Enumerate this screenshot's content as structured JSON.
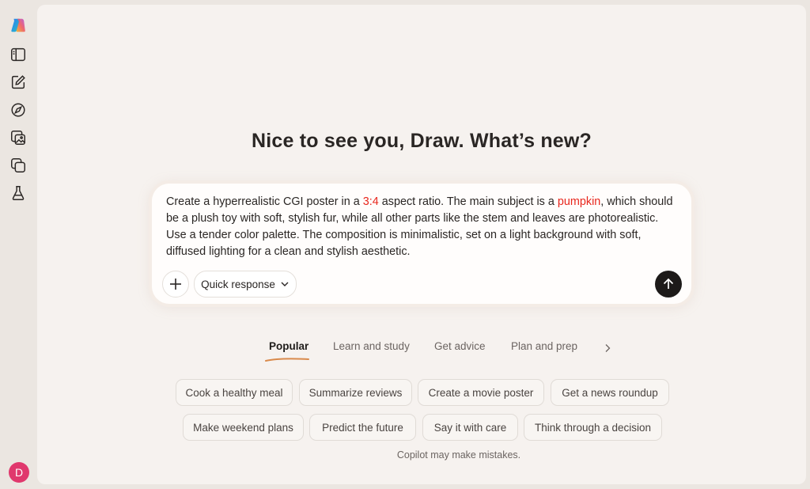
{
  "sidebar": {
    "icons": [
      "copilot-logo-icon",
      "sidebar-toggle-icon",
      "new-chat-icon",
      "discover-icon",
      "imagine-icon",
      "pages-icon",
      "labs-icon"
    ],
    "avatar_initial": "D",
    "avatar_color": "#e0386d"
  },
  "greeting": "Nice to see you, Draw. What’s new?",
  "composer": {
    "prompt_parts": [
      "Create a hyperrealistic CGI poster in a ",
      "3:4",
      " aspect ratio. The main subject is a ",
      "pumpkin",
      ", which should be a plush toy with soft, stylish fur, while all other parts like the stem and leaves are photorealistic. Use a tender color palette. The composition is minimalistic, set on a light background with soft, diffused lighting for a clean and stylish aesthetic."
    ],
    "highlight_color": "#e8261c",
    "mode_label": "Quick response"
  },
  "tabs": [
    {
      "label": "Popular",
      "active": true
    },
    {
      "label": "Learn and study",
      "active": false
    },
    {
      "label": "Get advice",
      "active": false
    },
    {
      "label": "Plan and prep",
      "active": false
    }
  ],
  "chips_row1": [
    "Cook a healthy meal",
    "Summarize reviews",
    "Create a movie poster",
    "Get a news roundup"
  ],
  "chips_row2": [
    "Make weekend plans",
    "Predict the future",
    "Say it with care",
    "Think through a decision"
  ],
  "disclaimer": "Copilot may make mistakes.",
  "colors": {
    "accent_underline": "#d98a4c",
    "send_button": "#1d1a19",
    "background": "#f6f2ef"
  }
}
